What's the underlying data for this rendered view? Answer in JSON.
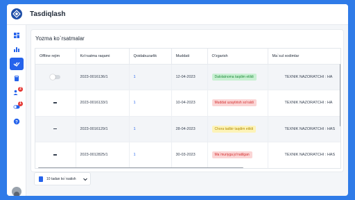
{
  "app": {
    "title": "Tasdiqlash"
  },
  "sidebar": {
    "items": [
      {
        "icon": "dashboard-icon",
        "active": false
      },
      {
        "icon": "chart-icon",
        "active": false
      },
      {
        "icon": "check-double-icon",
        "active": true
      },
      {
        "icon": "book-icon",
        "active": false
      },
      {
        "icon": "users-icon",
        "active": false,
        "badge": "2"
      },
      {
        "icon": "toggle-icon",
        "active": false,
        "badge": "1"
      },
      {
        "icon": "help-icon",
        "active": false
      }
    ]
  },
  "card": {
    "title": "Yozma ko`rsatmalar",
    "columns": [
      "Offline rejim",
      "Ko'rsatma raqami",
      "Qoidabuzarlik",
      "Muddati",
      "O'zgarish",
      "Ma`sul xodimlar"
    ],
    "rows": [
      {
        "offline": "toggle",
        "number": "2023-0016136/1",
        "violations": "1",
        "deadline": "12-04-2023",
        "status": "Dalolatnoma taqdim etildi",
        "status_color": "green",
        "responsible": "TEXNIK NAZORATCHI : HA"
      },
      {
        "offline": "dash",
        "number": "2023-0016133/1",
        "violations": "1",
        "deadline": "10-04-2023",
        "status": "Muddat uzaytirish so'raldi",
        "status_color": "red",
        "responsible": "TEXNIK NAZORATCHI : HA"
      },
      {
        "offline": "dash",
        "number": "2023-0016129/1",
        "violations": "1",
        "deadline": "28-04-2023",
        "status": "Chora tadbir taqdim etildi",
        "status_color": "yellow",
        "responsible": "TEXNIK NAZORATCHI : HAS"
      },
      {
        "offline": "dash",
        "number": "2023-0012825/1",
        "violations": "1",
        "deadline": "30-03-2023",
        "status": "Ma`muriyga jo'natilgan",
        "status_color": "red",
        "responsible": "TEXNIK NAZORATCHI : HAS"
      }
    ]
  },
  "pager": {
    "label": "10 tadan ko`rsatish"
  },
  "colors": {
    "background": "#2f7be8",
    "accent": "#2563eb",
    "green_bg": "#c9f0d3",
    "green_fg": "#1e8c3a",
    "red_bg": "#fbd5d5",
    "red_fg": "#d32f2f",
    "yellow_bg": "#fdf3b8",
    "yellow_fg": "#b08a00"
  }
}
